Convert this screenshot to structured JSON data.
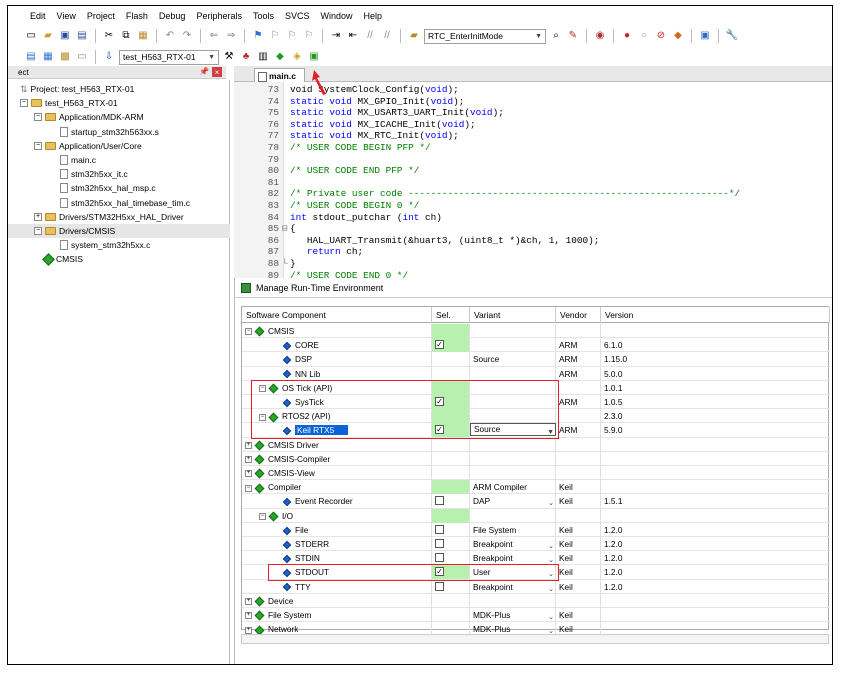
{
  "menu": [
    "Edit",
    "View",
    "Project",
    "Flash",
    "Debug",
    "Peripherals",
    "Tools",
    "SVCS",
    "Window",
    "Help"
  ],
  "toolbar": {
    "function_combo": "RTC_EnterInitMode",
    "target_combo": "test_H563_RTX-01"
  },
  "project_pane": {
    "header": "ect",
    "tree": [
      {
        "label": "Project: test_H563_RTX-01",
        "kind": "project"
      },
      {
        "label": "test_H563_RTX-01",
        "kind": "target"
      },
      {
        "label": "Application/MDK-ARM",
        "kind": "folder"
      },
      {
        "label": "startup_stm32h563xx.s",
        "kind": "file"
      },
      {
        "label": "Application/User/Core",
        "kind": "folder"
      },
      {
        "label": "main.c",
        "kind": "file"
      },
      {
        "label": "stm32h5xx_it.c",
        "kind": "file"
      },
      {
        "label": "stm32h5xx_hal_msp.c",
        "kind": "file"
      },
      {
        "label": "stm32h5xx_hal_timebase_tim.c",
        "kind": "file"
      },
      {
        "label": "Drivers/STM32H5xx_HAL_Driver",
        "kind": "folder"
      },
      {
        "label": "Drivers/CMSIS",
        "kind": "folder"
      },
      {
        "label": "system_stm32h5xx.c",
        "kind": "file"
      },
      {
        "label": "CMSIS",
        "kind": "component"
      }
    ]
  },
  "editor": {
    "tab": "main.c",
    "lines": [
      {
        "n": "73",
        "parts": [
          [
            "pp",
            "void SystemClock_Config("
          ],
          [
            "kw",
            "void"
          ],
          [
            "pp",
            ");"
          ]
        ]
      },
      {
        "n": "74",
        "parts": [
          [
            "kw",
            "static void"
          ],
          [
            "pp",
            " MX_GPIO_Init("
          ],
          [
            "kw",
            "void"
          ],
          [
            "pp",
            ");"
          ]
        ]
      },
      {
        "n": "75",
        "parts": [
          [
            "kw",
            "static void"
          ],
          [
            "pp",
            " MX_USART3_UART_Init("
          ],
          [
            "kw",
            "void"
          ],
          [
            "pp",
            ");"
          ]
        ]
      },
      {
        "n": "76",
        "parts": [
          [
            "kw",
            "static void"
          ],
          [
            "pp",
            " MX_ICACHE_Init("
          ],
          [
            "kw",
            "void"
          ],
          [
            "pp",
            ");"
          ]
        ]
      },
      {
        "n": "77",
        "parts": [
          [
            "kw",
            "static void"
          ],
          [
            "pp",
            " MX_RTC_Init("
          ],
          [
            "kw",
            "void"
          ],
          [
            "pp",
            ");"
          ]
        ]
      },
      {
        "n": "78",
        "parts": [
          [
            "cm",
            "/* USER CODE BEGIN PFP */"
          ]
        ]
      },
      {
        "n": "79",
        "parts": []
      },
      {
        "n": "80",
        "parts": [
          [
            "cm",
            "/* USER CODE END PFP */"
          ]
        ]
      },
      {
        "n": "81",
        "parts": []
      },
      {
        "n": "82",
        "parts": [
          [
            "cm",
            "/* Private user code ---------------------------------------------------------*/"
          ]
        ]
      },
      {
        "n": "83",
        "parts": [
          [
            "cm",
            "/* USER CODE BEGIN 0 */"
          ]
        ]
      },
      {
        "n": "84",
        "parts": [
          [
            "kw",
            "int"
          ],
          [
            "pp",
            " stdout_putchar ("
          ],
          [
            "kw",
            "int"
          ],
          [
            "pp",
            " ch)"
          ]
        ]
      },
      {
        "n": "85",
        "fold": "⊟",
        "parts": [
          [
            "pp",
            "{"
          ]
        ]
      },
      {
        "n": "86",
        "parts": [
          [
            "pp",
            "   HAL_UART_Transmit(&huart3, (uint8_t *)&ch, 1, 1000);"
          ]
        ]
      },
      {
        "n": "87",
        "parts": [
          [
            "pp",
            "   "
          ],
          [
            "kw",
            "return"
          ],
          [
            "pp",
            " ch;"
          ]
        ]
      },
      {
        "n": "88",
        "fold": "└",
        "parts": [
          [
            "pp",
            "}"
          ]
        ]
      },
      {
        "n": "89",
        "parts": [
          [
            "cm",
            "/* USER CODE END 0 */"
          ]
        ]
      }
    ]
  },
  "dialog": {
    "title": "Manage Run-Time Environment",
    "columns": [
      "Software Component",
      "Sel.",
      "Variant",
      "Vendor",
      "Version"
    ],
    "rows": [
      {
        "indent": 0,
        "pm": "−",
        "icon": "green",
        "name": "CMSIS",
        "sel": "green",
        "checked": false,
        "variant": "",
        "dd": false,
        "vendor": "",
        "version": ""
      },
      {
        "indent": 2,
        "pm": "",
        "icon": "blue",
        "name": "CORE",
        "sel": "green",
        "checked": true,
        "variant": "",
        "dd": false,
        "vendor": "ARM",
        "version": "6.1.0"
      },
      {
        "indent": 2,
        "pm": "",
        "icon": "blue",
        "name": "DSP",
        "sel": "",
        "checked": false,
        "variant": "Source",
        "dd": false,
        "vendor": "ARM",
        "version": "1.15.0"
      },
      {
        "indent": 2,
        "pm": "",
        "icon": "blue",
        "name": "NN Lib",
        "sel": "",
        "checked": false,
        "variant": "",
        "dd": false,
        "vendor": "ARM",
        "version": "5.0.0"
      },
      {
        "indent": 1,
        "pm": "−",
        "icon": "green",
        "name": "OS Tick (API)",
        "sel": "green",
        "checked": false,
        "variant": "",
        "dd": false,
        "vendor": "",
        "version": "1.0.1"
      },
      {
        "indent": 2,
        "pm": "",
        "icon": "blue",
        "name": "SysTick",
        "sel": "green",
        "checked": true,
        "variant": "",
        "dd": false,
        "vendor": "ARM",
        "version": "1.0.5"
      },
      {
        "indent": 1,
        "pm": "−",
        "icon": "green",
        "name": "RTOS2 (API)",
        "sel": "green",
        "checked": false,
        "variant": "",
        "dd": false,
        "vendor": "",
        "version": "2.3.0"
      },
      {
        "indent": 2,
        "pm": "",
        "icon": "blue",
        "name": "Keil RTX5",
        "sel": "green",
        "checked": true,
        "variant": "Source",
        "dd": true,
        "vendor": "ARM",
        "version": "5.9.0",
        "selected": true
      },
      {
        "indent": 0,
        "pm": "+",
        "icon": "green",
        "name": "CMSIS Driver",
        "sel": "",
        "checked": false,
        "variant": "",
        "dd": false,
        "vendor": "",
        "version": ""
      },
      {
        "indent": 0,
        "pm": "+",
        "icon": "green",
        "name": "CMSIS-Compiler",
        "sel": "",
        "checked": false,
        "variant": "",
        "dd": false,
        "vendor": "",
        "version": ""
      },
      {
        "indent": 0,
        "pm": "+",
        "icon": "green",
        "name": "CMSIS-View",
        "sel": "",
        "checked": false,
        "variant": "",
        "dd": false,
        "vendor": "",
        "version": ""
      },
      {
        "indent": 0,
        "pm": "−",
        "icon": "green",
        "name": "Compiler",
        "sel": "green",
        "checked": false,
        "variant": "ARM Compiler",
        "dd": false,
        "vendor": "Keil",
        "version": ""
      },
      {
        "indent": 2,
        "pm": "",
        "icon": "blue",
        "name": "Event Recorder",
        "sel": "",
        "checked": false,
        "variant": "DAP",
        "dd": true,
        "vendor": "Keil",
        "version": "1.5.1"
      },
      {
        "indent": 1,
        "pm": "−",
        "icon": "green",
        "name": "I/O",
        "sel": "green",
        "checked": false,
        "variant": "",
        "dd": false,
        "vendor": "",
        "version": ""
      },
      {
        "indent": 2,
        "pm": "",
        "icon": "blue",
        "name": "File",
        "sel": "",
        "checked": false,
        "variant": "File System",
        "dd": false,
        "vendor": "Keil",
        "version": "1.2.0"
      },
      {
        "indent": 2,
        "pm": "",
        "icon": "blue",
        "name": "STDERR",
        "sel": "",
        "checked": false,
        "variant": "Breakpoint",
        "dd": true,
        "vendor": "Keil",
        "version": "1.2.0"
      },
      {
        "indent": 2,
        "pm": "",
        "icon": "blue",
        "name": "STDIN",
        "sel": "",
        "checked": false,
        "variant": "Breakpoint",
        "dd": true,
        "vendor": "Keil",
        "version": "1.2.0"
      },
      {
        "indent": 2,
        "pm": "",
        "icon": "blue",
        "name": "STDOUT",
        "sel": "green",
        "checked": true,
        "variant": "User",
        "dd": true,
        "vendor": "Keil",
        "version": "1.2.0"
      },
      {
        "indent": 2,
        "pm": "",
        "icon": "blue",
        "name": "TTY",
        "sel": "",
        "checked": false,
        "variant": "Breakpoint",
        "dd": true,
        "vendor": "Keil",
        "version": "1.2.0"
      },
      {
        "indent": 0,
        "pm": "+",
        "icon": "green",
        "name": "Device",
        "sel": "",
        "checked": false,
        "variant": "",
        "dd": false,
        "vendor": "",
        "version": ""
      },
      {
        "indent": 0,
        "pm": "+",
        "icon": "green",
        "name": "File System",
        "sel": "",
        "checked": false,
        "variant": "MDK-Plus",
        "dd": true,
        "vendor": "Keil",
        "version": ""
      },
      {
        "indent": 0,
        "pm": "+",
        "icon": "green",
        "name": "Network",
        "sel": "",
        "checked": false,
        "variant": "MDK-Plus",
        "dd": true,
        "vendor": "Keil",
        "version": ""
      }
    ]
  },
  "colors": {
    "highlight_box": "#e0202a",
    "selected_row": "#0a64d8",
    "sel_green": "#b8f0b0",
    "keyword": "#0000ff",
    "comment": "#008000"
  }
}
